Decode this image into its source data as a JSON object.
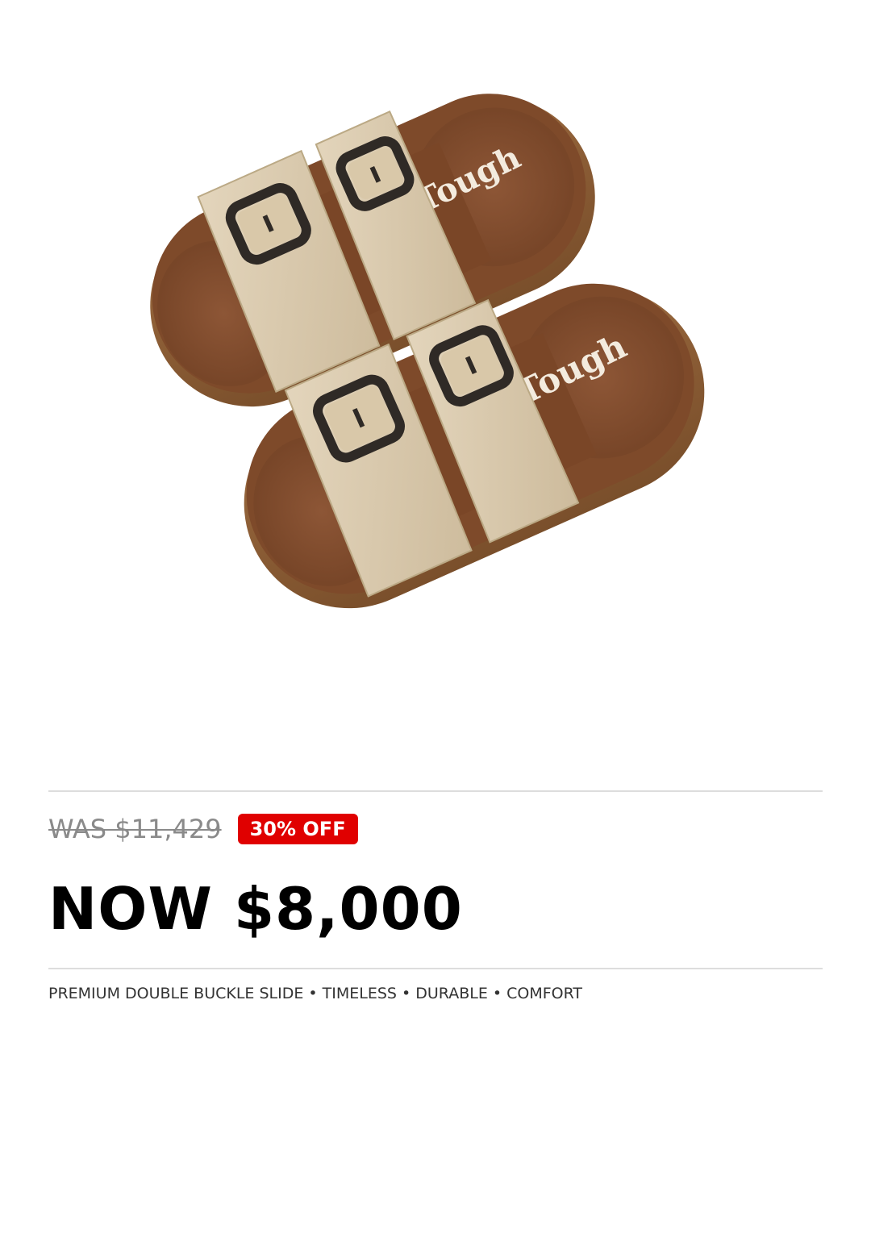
{
  "product": {
    "brand_mark": "Tough",
    "image_icon": "double-buckle-slide-sandals-image"
  },
  "pricing": {
    "was_label": "WAS $11,429",
    "badge_label": "30% OFF",
    "now_label": "NOW $8,000",
    "badge_color": "#e00000"
  },
  "features": {
    "text": "PREMIUM DOUBLE BUCKLE SLIDE • TIMELESS • DURABLE • COMFORT"
  }
}
